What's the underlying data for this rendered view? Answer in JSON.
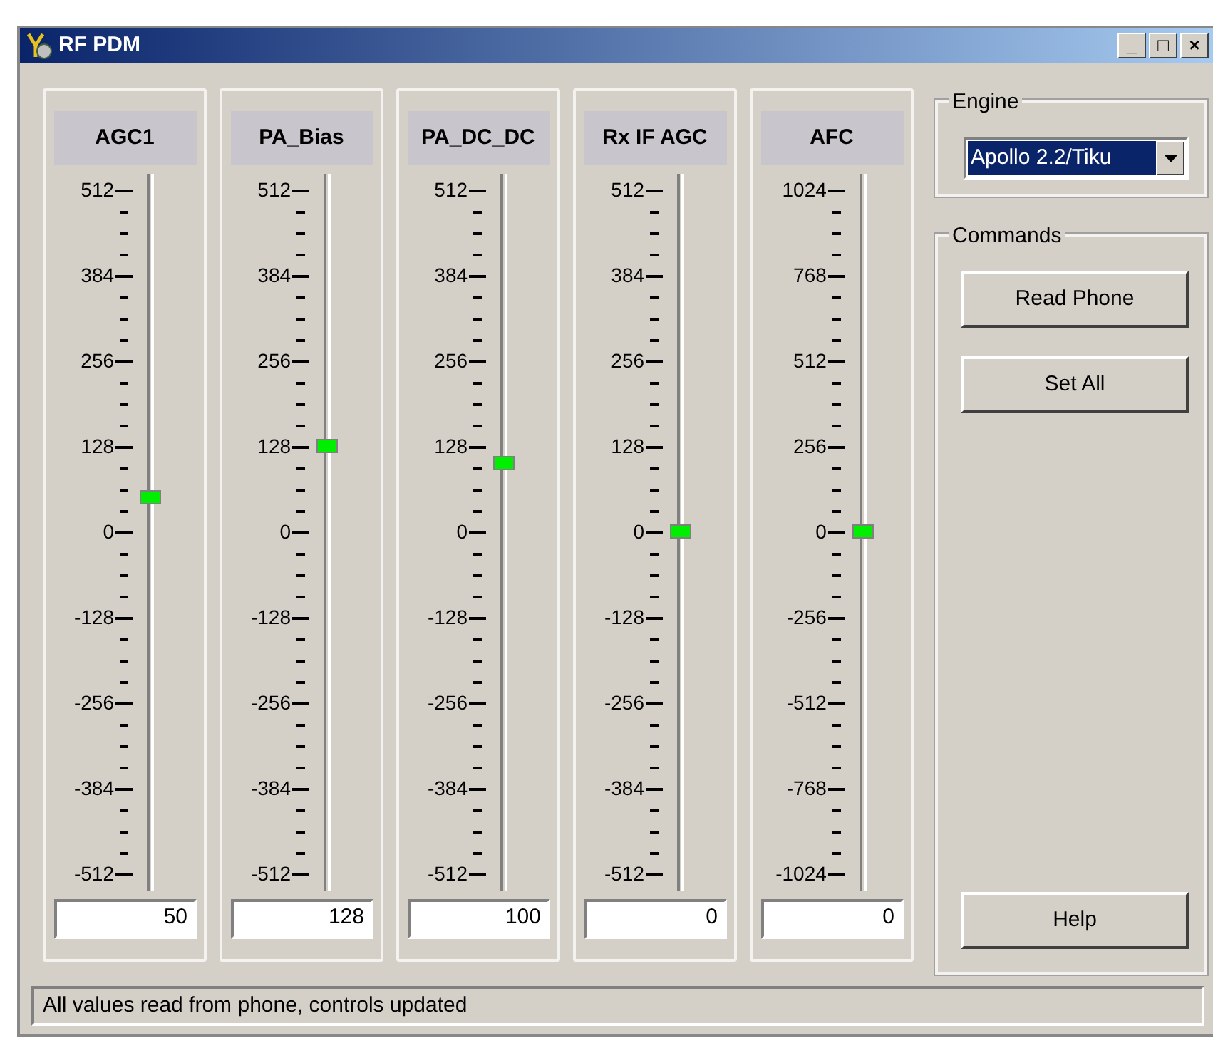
{
  "window": {
    "title": "RF PDM",
    "controls": [
      "_",
      "□",
      "×"
    ]
  },
  "sliders": [
    {
      "label": "AGC1",
      "ticks": [
        "512",
        "384",
        "256",
        "128",
        "0",
        "-128",
        "-256",
        "-384",
        "-512"
      ],
      "level": 0.549,
      "value": "50"
    },
    {
      "label": "PA_Bias",
      "ticks": [
        "512",
        "384",
        "256",
        "128",
        "0",
        "-128",
        "-256",
        "-384",
        "-512"
      ],
      "level": 0.625,
      "value": "128"
    },
    {
      "label": "PA_DC_DC",
      "ticks": [
        "512",
        "384",
        "256",
        "128",
        "0",
        "-128",
        "-256",
        "-384",
        "-512"
      ],
      "level": 0.598,
      "value": "100"
    },
    {
      "label": "Rx IF AGC",
      "ticks": [
        "512",
        "384",
        "256",
        "128",
        "0",
        "-128",
        "-256",
        "-384",
        "-512"
      ],
      "level": 0.5,
      "value": "0"
    },
    {
      "label": "AFC",
      "ticks": [
        "1024",
        "768",
        "512",
        "256",
        "0",
        "-256",
        "-512",
        "-768",
        "-1024"
      ],
      "level": 0.5,
      "value": "0"
    }
  ],
  "engine": {
    "title": "Engine",
    "selected_value": "Apollo 2.2/Tiku"
  },
  "commands": {
    "title": "Commands",
    "buttons": [
      "Read Phone",
      "Set All"
    ],
    "help_button": "Help"
  },
  "status_bar": "All values read from phone, controls updated"
}
